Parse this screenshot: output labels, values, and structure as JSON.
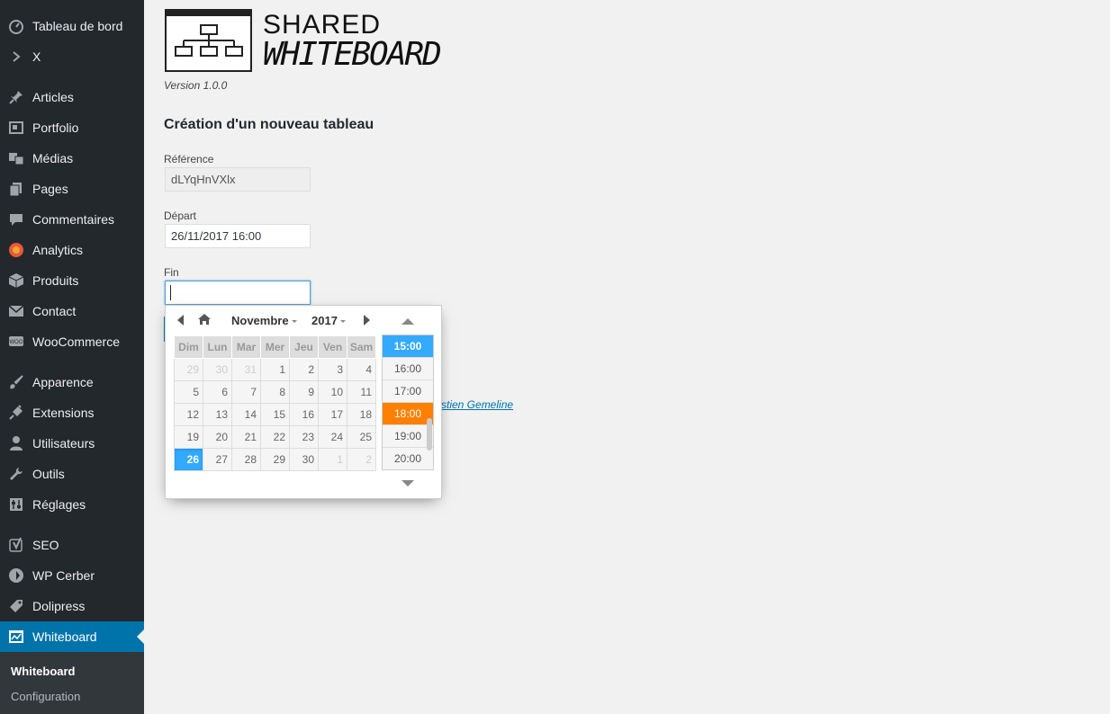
{
  "sidebar": {
    "items": [
      {
        "label": "Tableau de bord",
        "icon": "dashboard-icon"
      },
      {
        "label": "X",
        "icon": "chevron-right-icon"
      },
      {
        "label": "Articles",
        "icon": "pin-icon"
      },
      {
        "label": "Portfolio",
        "icon": "portfolio-icon"
      },
      {
        "label": "Médias",
        "icon": "media-icon"
      },
      {
        "label": "Pages",
        "icon": "pages-icon"
      },
      {
        "label": "Commentaires",
        "icon": "comment-icon"
      },
      {
        "label": "Analytics",
        "icon": "analytics-icon"
      },
      {
        "label": "Produits",
        "icon": "box-icon"
      },
      {
        "label": "Contact",
        "icon": "envelope-icon"
      },
      {
        "label": "WooCommerce",
        "icon": "woocommerce-icon"
      },
      {
        "label": "Apparence",
        "icon": "brush-icon"
      },
      {
        "label": "Extensions",
        "icon": "plugin-icon"
      },
      {
        "label": "Utilisateurs",
        "icon": "user-icon"
      },
      {
        "label": "Outils",
        "icon": "wrench-icon"
      },
      {
        "label": "Réglages",
        "icon": "settings-icon"
      },
      {
        "label": "SEO",
        "icon": "yoast-icon"
      },
      {
        "label": "WP Cerber",
        "icon": "shield-icon"
      },
      {
        "label": "Dolipress",
        "icon": "tag-icon"
      },
      {
        "label": "Whiteboard",
        "icon": "whiteboard-icon"
      }
    ],
    "submenu": [
      "Whiteboard",
      "Configuration"
    ]
  },
  "logo": {
    "line1": "SHARED",
    "line2": "WHITEBOARD"
  },
  "version": "Version 1.0.0",
  "title": "Création d'un nouveau tableau",
  "form": {
    "reference_label": "Référence",
    "reference_value": "dLYqHnVXlx",
    "start_label": "Départ",
    "start_value": "26/11/2017 16:00",
    "end_label": "Fin",
    "end_value": ""
  },
  "background_link": "stien Gemeline",
  "picker": {
    "month": "Novembre",
    "year": "2017",
    "weekdays": [
      "Dim",
      "Lun",
      "Mar",
      "Mer",
      "Jeu",
      "Ven",
      "Sam"
    ],
    "weeks": [
      [
        "29",
        "30",
        "31",
        "1",
        "2",
        "3",
        "4"
      ],
      [
        "5",
        "6",
        "7",
        "8",
        "9",
        "10",
        "11"
      ],
      [
        "12",
        "13",
        "14",
        "15",
        "16",
        "17",
        "18"
      ],
      [
        "19",
        "20",
        "21",
        "22",
        "23",
        "24",
        "25"
      ],
      [
        "26",
        "27",
        "28",
        "29",
        "30",
        "1",
        "2"
      ]
    ],
    "selected_day": "26",
    "times": [
      "15:00",
      "16:00",
      "17:00",
      "18:00",
      "19:00",
      "20:00"
    ],
    "selected_time": "15:00",
    "hover_time": "18:00"
  },
  "colors": {
    "sidebar_bg": "#23282d",
    "active_bg": "#0073aa",
    "selected_day": "#33aaff",
    "hover_time": "#ff8000"
  }
}
